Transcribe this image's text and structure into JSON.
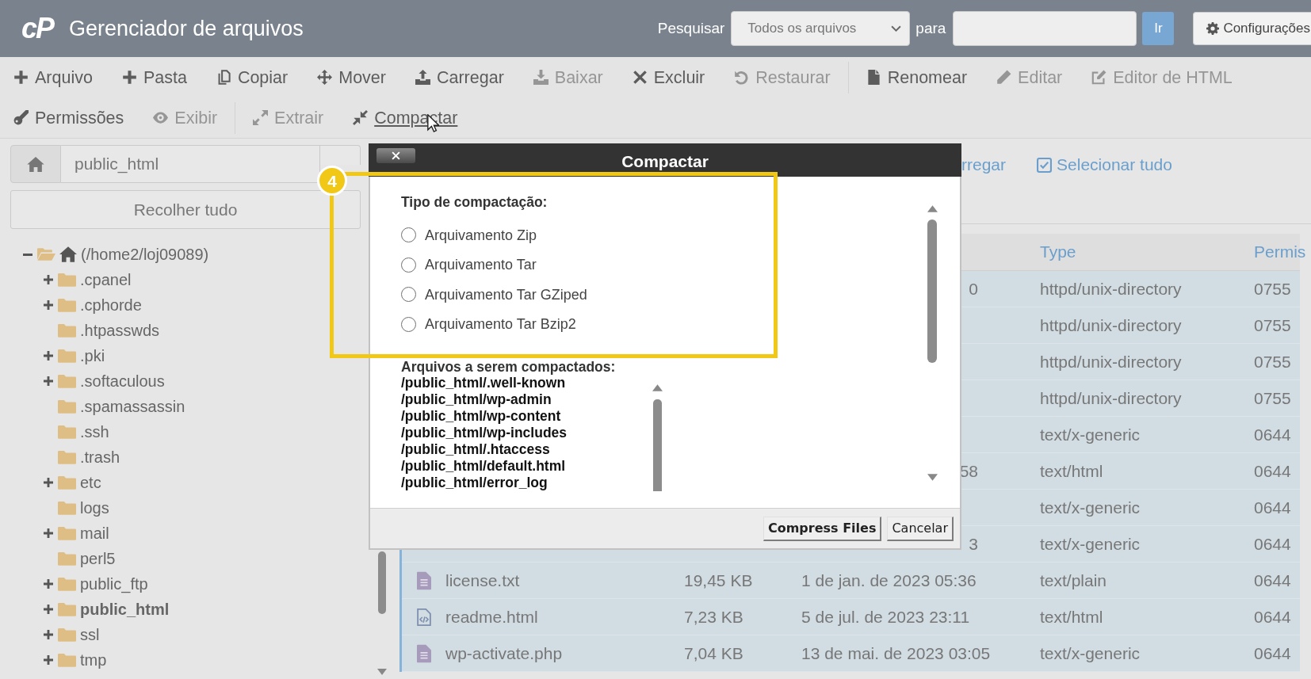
{
  "header": {
    "logo": "cP",
    "title": "Gerenciador de arquivos",
    "search_label": "Pesquisar",
    "search_scope": "Todos os arquivos",
    "for_label": "para",
    "go_button": "Ir",
    "settings_button": "Configurações"
  },
  "toolbar": {
    "rows": [
      {
        "groups": [
          {
            "items": [
              {
                "label": "Arquivo",
                "disabled": false,
                "hovered": false
              },
              {
                "label": "Pasta",
                "disabled": false,
                "hovered": false
              },
              {
                "label": "Copiar",
                "disabled": false,
                "hovered": false
              },
              {
                "label": "Mover",
                "disabled": false,
                "hovered": false
              },
              {
                "label": "Carregar",
                "disabled": false,
                "hovered": false
              },
              {
                "label": "Baixar",
                "disabled": true,
                "hovered": false
              },
              {
                "label": "Excluir",
                "disabled": false,
                "hovered": false
              },
              {
                "label": "Restaurar",
                "disabled": true,
                "hovered": false
              }
            ]
          },
          {
            "items": [
              {
                "label": "Renomear",
                "disabled": false,
                "hovered": false
              },
              {
                "label": "Editar",
                "disabled": true,
                "hovered": false
              },
              {
                "label": "Editor de HTML",
                "disabled": true,
                "hovered": false
              }
            ]
          }
        ]
      },
      {
        "groups": [
          {
            "items": [
              {
                "label": "Permissões",
                "disabled": false,
                "hovered": false
              },
              {
                "label": "Exibir",
                "disabled": true,
                "hovered": false
              }
            ]
          },
          {
            "items": [
              {
                "label": "Extrair",
                "disabled": true,
                "hovered": false
              },
              {
                "label": "Compactar",
                "disabled": false,
                "hovered": true
              }
            ]
          }
        ]
      }
    ]
  },
  "sidebar": {
    "path_field": {
      "value": "public_html"
    },
    "collapse_button": "Recolher tudo",
    "tree": {
      "label": "(/home2/loj09089)",
      "expanded": true,
      "selected": false,
      "children": [
        {
          "label": ".cpanel",
          "expanded": false,
          "selected": false
        },
        {
          "label": ".cphorde",
          "expanded": false,
          "selected": false
        },
        {
          "label": ".htpasswds",
          "selected": false
        },
        {
          "label": ".pki",
          "expanded": false,
          "selected": false
        },
        {
          "label": ".softaculous",
          "expanded": false,
          "selected": false
        },
        {
          "label": ".spamassassin",
          "selected": false
        },
        {
          "label": ".ssh",
          "selected": false
        },
        {
          "label": ".trash",
          "selected": false
        },
        {
          "label": "etc",
          "expanded": false,
          "selected": false
        },
        {
          "label": "logs",
          "selected": false
        },
        {
          "label": "mail",
          "expanded": false,
          "selected": false
        },
        {
          "label": "perl5",
          "selected": false
        },
        {
          "label": "public_ftp",
          "expanded": false,
          "selected": false
        },
        {
          "label": "public_html",
          "expanded": false,
          "selected": true
        },
        {
          "label": "ssl",
          "expanded": false,
          "selected": false
        },
        {
          "label": "tmp",
          "expanded": false,
          "selected": false
        }
      ]
    }
  },
  "file_panel": {
    "actions": [
      {
        "label": "rregar"
      },
      {
        "label": "Selecionar tudo"
      }
    ],
    "table": {
      "columns": [
        {
          "label": "Type"
        },
        {
          "label": "Permis"
        }
      ],
      "rows": [
        {
          "selected": true,
          "date": "0",
          "type": "httpd/unix-directory",
          "permissions": "0755"
        },
        {
          "selected": true,
          "type": "httpd/unix-directory",
          "permissions": "0755"
        },
        {
          "selected": true,
          "type": "httpd/unix-directory",
          "permissions": "0755"
        },
        {
          "selected": true,
          "type": "httpd/unix-directory",
          "permissions": "0755"
        },
        {
          "selected": true,
          "type": "text/x-generic",
          "permissions": "0644"
        },
        {
          "selected": true,
          "date": "58",
          "type": "text/html",
          "permissions": "0644"
        },
        {
          "selected": true,
          "type": "text/x-generic",
          "permissions": "0644"
        },
        {
          "selected": true,
          "date": "3",
          "type": "text/x-generic",
          "permissions": "0644"
        },
        {
          "selected": true,
          "kind": "text",
          "name": "license.txt",
          "size": "19,45 KB",
          "date": "1 de jan. de 2023 05:36",
          "type": "text/plain",
          "permissions": "0644"
        },
        {
          "selected": true,
          "kind": "code",
          "name": "readme.html",
          "size": "7,23 KB",
          "date": "5 de jul. de 2023 23:11",
          "type": "text/html",
          "permissions": "0644"
        },
        {
          "selected": true,
          "kind": "text",
          "name": "wp-activate.php",
          "size": "7,04 KB",
          "date": "13 de mai. de 2023 03:05",
          "type": "text/x-generic",
          "permissions": "0644"
        }
      ]
    }
  },
  "dialog": {
    "title": "Compactar",
    "type_label": "Tipo de compactação:",
    "options": [
      {
        "label": "Arquivamento Zip",
        "selected": false
      },
      {
        "label": "Arquivamento Tar",
        "selected": false
      },
      {
        "label": "Arquivamento Tar GZiped",
        "selected": false
      },
      {
        "label": "Arquivamento Tar Bzip2",
        "selected": false
      }
    ],
    "files_label": "Arquivos a serem compactados:",
    "files": [
      "/public_html/.well-known",
      "/public_html/wp-admin",
      "/public_html/wp-content",
      "/public_html/wp-includes",
      "/public_html/.htaccess",
      "/public_html/default.html",
      "/public_html/error_log"
    ],
    "buttons": [
      {
        "label": "Compress Files",
        "primary": true
      },
      {
        "label": "Cancelar",
        "primary": false
      }
    ]
  },
  "annotation": {
    "number": "4"
  }
}
